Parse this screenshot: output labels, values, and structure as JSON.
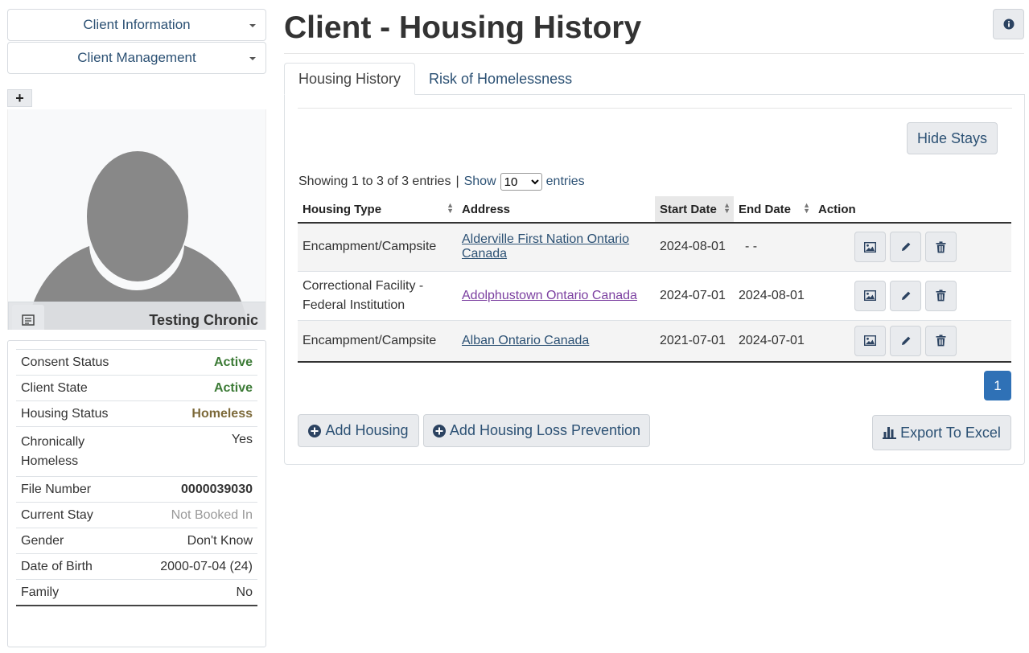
{
  "sidebar": {
    "menus": [
      "Client Information",
      "Client Management"
    ],
    "add_symbol": "+",
    "client_name": "Testing Chronic",
    "details": [
      {
        "label": "Consent Status",
        "value": "Active",
        "style": "active"
      },
      {
        "label": "Client State",
        "value": "Active",
        "style": "active"
      },
      {
        "label": "Housing Status",
        "value": "Homeless",
        "style": "homeless"
      },
      {
        "label": "Chronically Homeless",
        "value": "Yes",
        "style": "plain"
      },
      {
        "label": "File Number",
        "value": "0000039030",
        "style": "bold"
      },
      {
        "label": "Current Stay",
        "value": "Not Booked In",
        "style": "muted"
      },
      {
        "label": "Gender",
        "value": "Don't Know",
        "style": "plain"
      },
      {
        "label": "Date of Birth",
        "value": "2000-07-04 (24)",
        "style": "plain"
      },
      {
        "label": "Family",
        "value": "No",
        "style": "plain"
      }
    ]
  },
  "header": {
    "title": "Client - Housing History"
  },
  "tabs": [
    {
      "label": "Housing History",
      "active": true
    },
    {
      "label": "Risk of Homelessness",
      "active": false
    }
  ],
  "toolbar": {
    "hide_stays_label": "Hide Stays"
  },
  "table_info": {
    "showing": "Showing 1 to 3 of 3 entries",
    "separator": "|",
    "show_label": "Show",
    "page_size": "10",
    "entries_label": "entries"
  },
  "table": {
    "columns": [
      "Housing Type",
      "Address",
      "Start Date",
      "End Date",
      "Action"
    ],
    "rows": [
      {
        "housing_type": "Encampment/Campsite",
        "address": "Alderville First Nation Ontario Canada",
        "start_date": "2024-08-01",
        "end_date": "- -"
      },
      {
        "housing_type": "Correctional Facility - Federal Institution",
        "address": "Adolphustown Ontario Canada",
        "start_date": "2024-07-01",
        "end_date": "2024-08-01"
      },
      {
        "housing_type": "Encampment/Campsite",
        "address": "Alban Ontario Canada",
        "start_date": "2021-07-01",
        "end_date": "2024-07-01"
      }
    ]
  },
  "pagination": {
    "current_page": "1"
  },
  "actions": {
    "add_housing_label": "Add Housing",
    "add_loss_prevention_label": "Add Housing Loss Prevention",
    "export_label": "Export To Excel"
  },
  "colors": {
    "link": "#2c5174",
    "active_status": "#3b7a35",
    "homeless_status": "#7d6a3a",
    "primary": "#2f71b6"
  },
  "icons": {
    "info": "info-circle-icon",
    "card": "id-card-icon",
    "image": "image-icon",
    "edit": "pencil-icon",
    "delete": "trash-icon",
    "plus_circle": "plus-circle-icon",
    "chart": "bar-chart-icon"
  }
}
